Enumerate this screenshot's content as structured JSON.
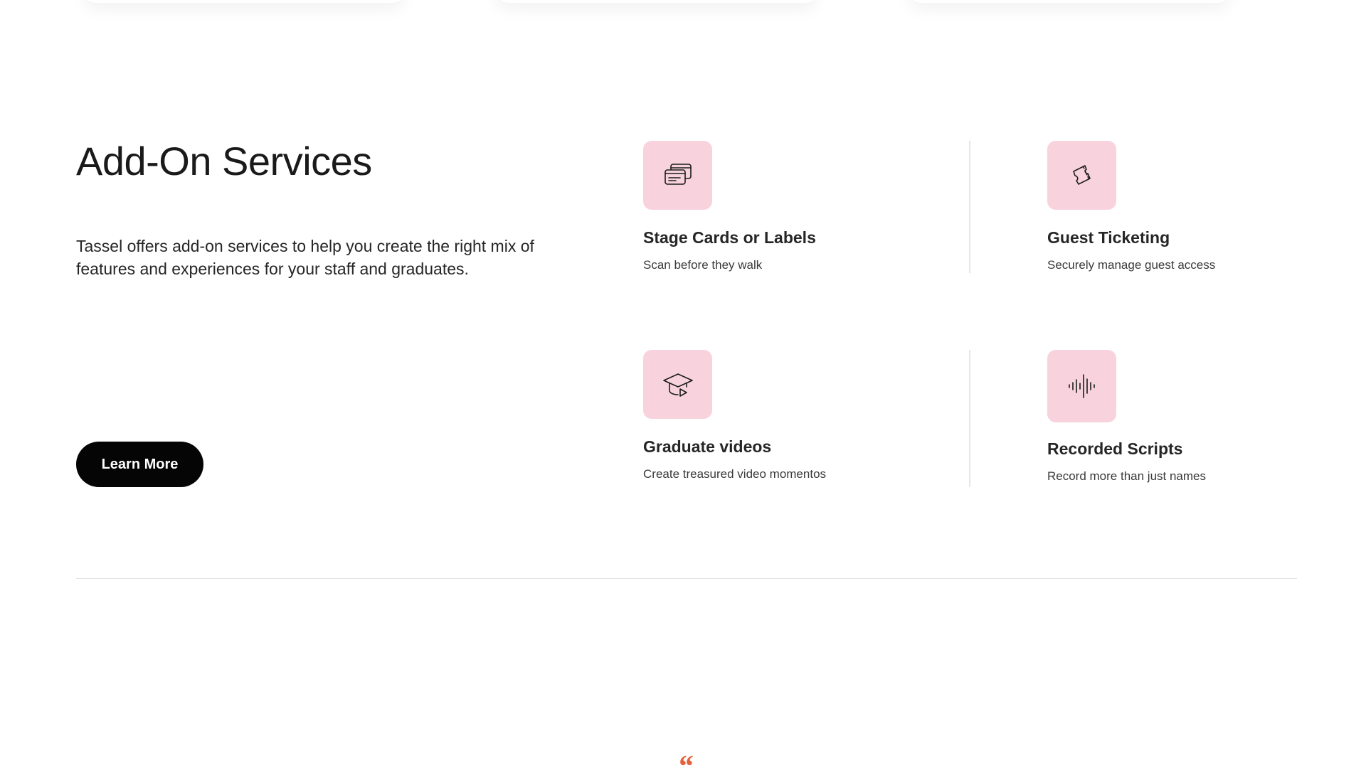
{
  "section": {
    "title": "Add-On Services",
    "description": "Tassel offers add-on services to help you create the right mix of features and experiences for your staff and graduates.",
    "cta_label": "Learn More"
  },
  "services": [
    {
      "title": "Stage Cards or Labels",
      "subtitle": "Scan before they walk",
      "icon": "stage-cards-icon"
    },
    {
      "title": "Guest Ticketing",
      "subtitle": "Securely manage guest access",
      "icon": "ticket-icon"
    },
    {
      "title": "Graduate videos",
      "subtitle": "Create treasured video momentos",
      "icon": "graduation-cap-video-icon"
    },
    {
      "title": "Recorded Scripts",
      "subtitle": "Record more than just names",
      "icon": "audio-waveform-icon"
    }
  ],
  "testimonial": {
    "quote_mark": "“"
  },
  "colors": {
    "icon_tile_bg": "#f8d3dd",
    "button_bg": "#050505",
    "quote_accent": "#e8603c",
    "divider": "#e4e4e4"
  }
}
